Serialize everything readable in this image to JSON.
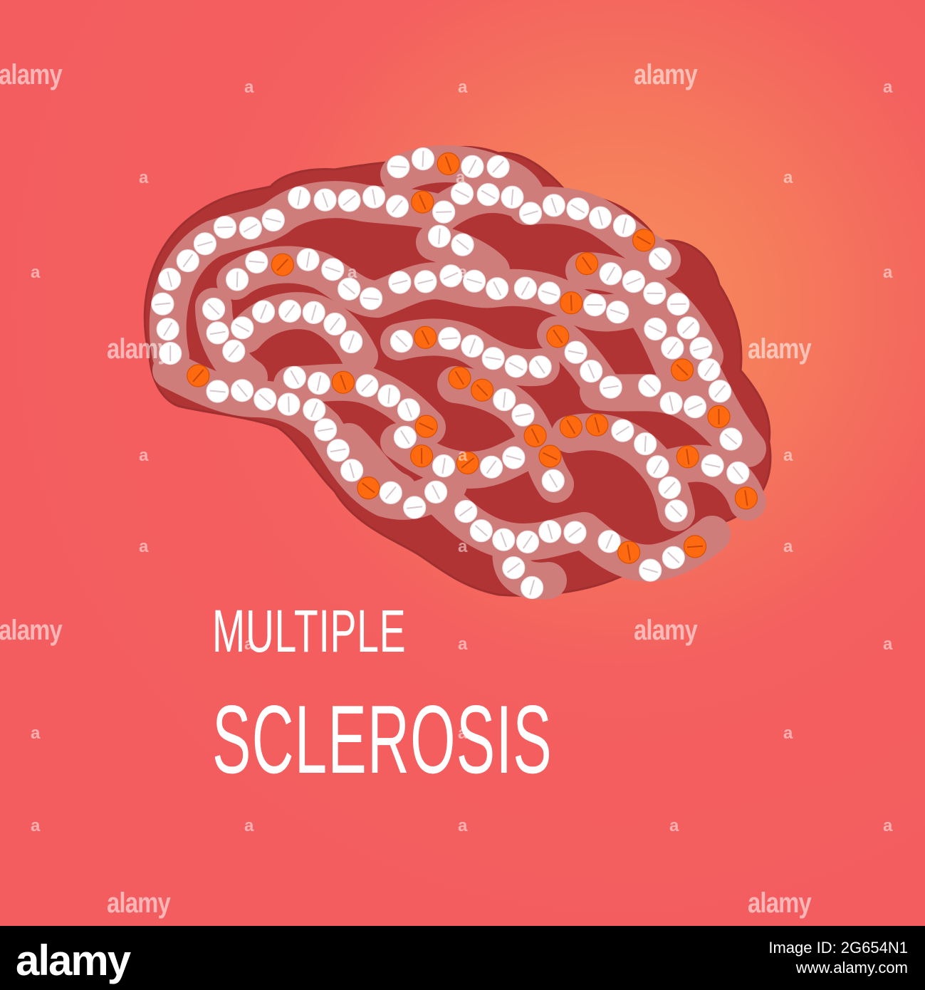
{
  "title": {
    "line1": "MULTIPLE",
    "line2": "SCLEROSIS"
  },
  "watermark": {
    "text": "alamy",
    "glyph": "a"
  },
  "footer": {
    "logo": "alamy",
    "image_id_line": "Image ID: 2G654N1",
    "url": "www.alamy.com"
  },
  "colors": {
    "background": "#f45f5f",
    "glow": "#f98d5e",
    "brain_outline": "#b13435",
    "brain_fold": "#cf7d7b",
    "pill_white": "#ffffff",
    "pill_orange": "#ff6a10"
  },
  "icons": {
    "main_illustration": "brain-made-of-pills-icon"
  }
}
